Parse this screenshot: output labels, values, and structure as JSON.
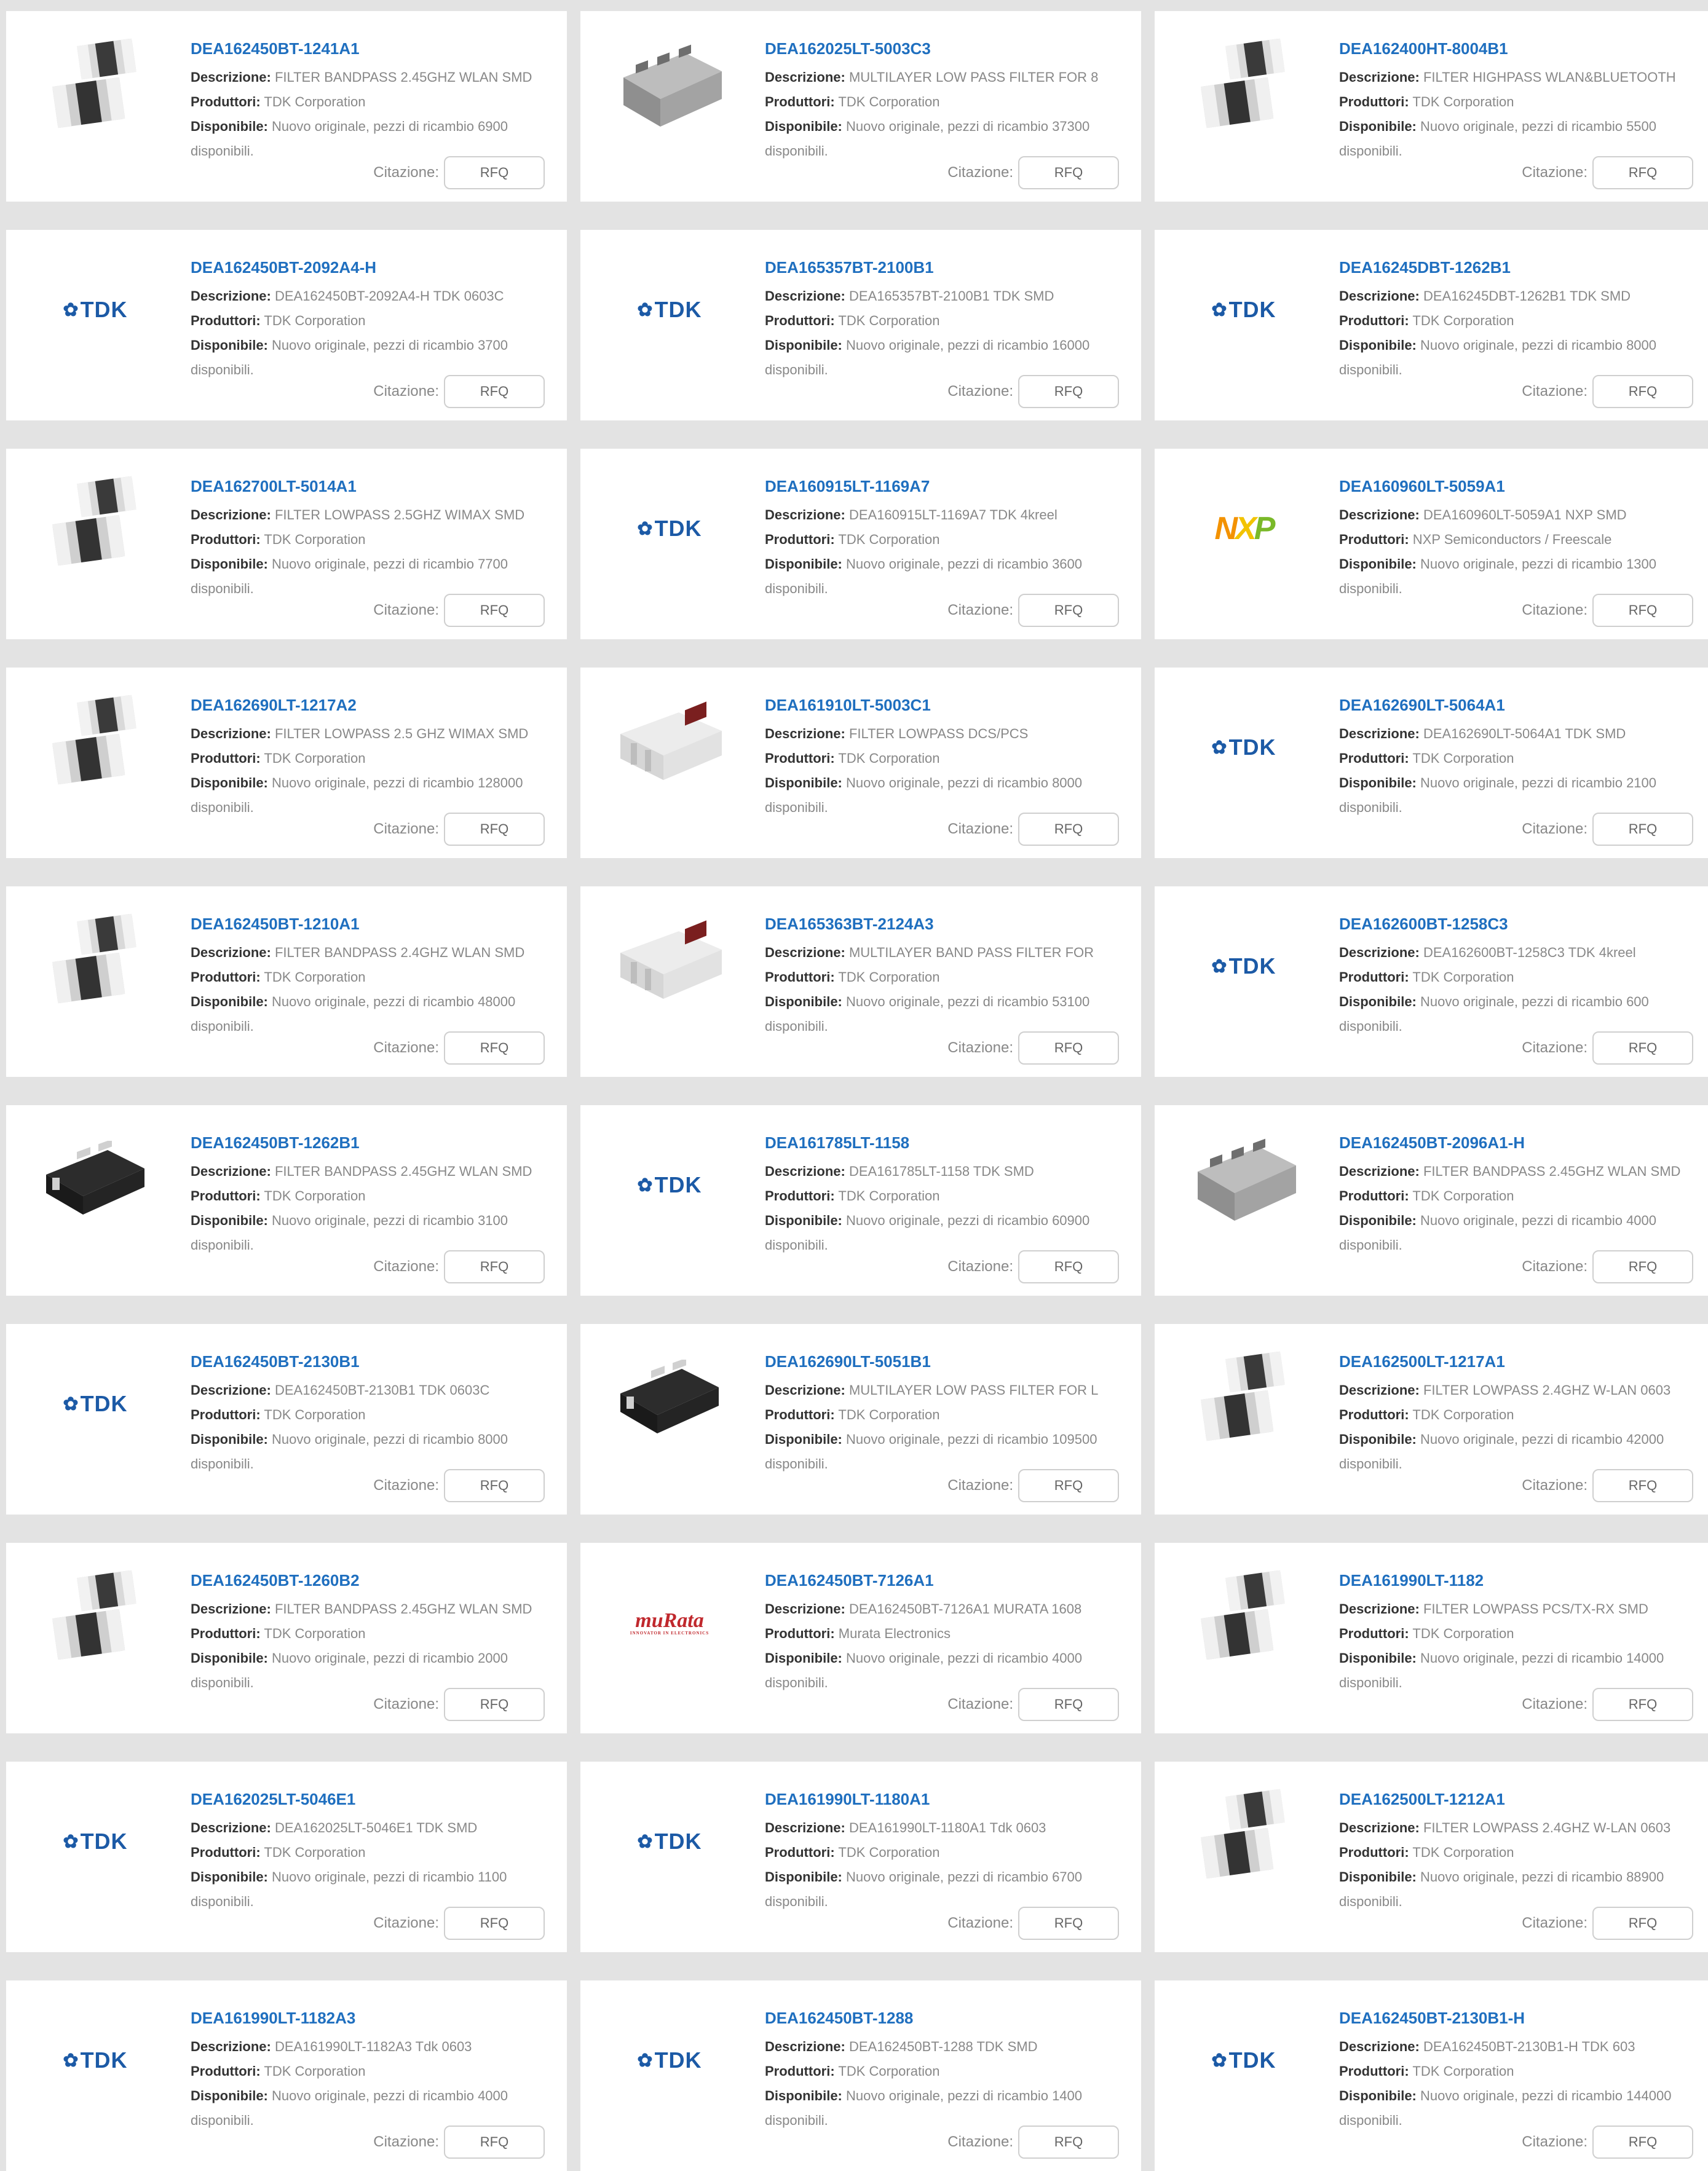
{
  "labels": {
    "descrizione": "Descrizione:",
    "produttori": "Produttori:",
    "disponibile": "Disponibile:",
    "citazione": "Citazione:",
    "rfq": "RFQ"
  },
  "brand_colors": {
    "link": "#1f6fbf",
    "tdk": "#1c5aa6",
    "murata": "#c0282d",
    "nxp_orange": "#f39200",
    "nxp_green": "#7ab929"
  },
  "products": [
    {
      "pn": "DEA162450BT-1241A1",
      "desc": "FILTER BANDPASS 2.45GHZ WLAN SMD",
      "mfr": "TDK Corporation",
      "avail": "Nuovo originale, pezzi di ricambio 6900 disponibili.",
      "img": "chip-pair-icon"
    },
    {
      "pn": "DEA162025LT-5003C3",
      "desc": "MULTILAYER LOW PASS FILTER FOR 8",
      "mfr": "TDK Corporation",
      "avail": "Nuovo originale, pezzi di ricambio 37300 disponibili.",
      "img": "chip-array-icon"
    },
    {
      "pn": "DEA162400HT-8004B1",
      "desc": "FILTER HIGHPASS WLAN&BLUETOOTH",
      "mfr": "TDK Corporation",
      "avail": "Nuovo originale, pezzi di ricambio 5500 disponibili.",
      "img": "chip-pair-icon"
    },
    {
      "pn": "DEA162450BT-2092A4-H",
      "desc": "DEA162450BT-2092A4-H TDK 0603C",
      "mfr": "TDK Corporation",
      "avail": "Nuovo originale, pezzi di ricambio 3700 disponibili.",
      "img": "tdk-logo"
    },
    {
      "pn": "DEA165357BT-2100B1",
      "desc": "DEA165357BT-2100B1 TDK SMD",
      "mfr": "TDK Corporation",
      "avail": "Nuovo originale, pezzi di ricambio 16000 disponibili.",
      "img": "tdk-logo"
    },
    {
      "pn": "DEA16245DBT-1262B1",
      "desc": "DEA16245DBT-1262B1 TDK SMD",
      "mfr": "TDK Corporation",
      "avail": "Nuovo originale, pezzi di ricambio 8000 disponibili.",
      "img": "tdk-logo"
    },
    {
      "pn": "DEA162700LT-5014A1",
      "desc": "FILTER LOWPASS 2.5GHZ WIMAX SMD",
      "mfr": "TDK Corporation",
      "avail": "Nuovo originale, pezzi di ricambio 7700 disponibili.",
      "img": "chip-pair-icon"
    },
    {
      "pn": "DEA160915LT-1169A7",
      "desc": "DEA160915LT-1169A7 TDK 4kreel",
      "mfr": "TDK Corporation",
      "avail": "Nuovo originale, pezzi di ricambio 3600 disponibili.",
      "img": "tdk-logo"
    },
    {
      "pn": "DEA160960LT-5059A1",
      "desc": "DEA160960LT-5059A1 NXP SMD",
      "mfr": "NXP Semiconductors / Freescale",
      "avail": "Nuovo originale, pezzi di ricambio 1300 disponibili.",
      "img": "nxp-logo"
    },
    {
      "pn": "DEA162690LT-1217A2",
      "desc": "FILTER LOWPASS 2.5 GHZ WIMAX SMD",
      "mfr": "TDK Corporation",
      "avail": "Nuovo originale, pezzi di ricambio 128000 disponibili.",
      "img": "chip-pair-icon"
    },
    {
      "pn": "DEA161910LT-5003C1",
      "desc": "FILTER LOWPASS DCS/PCS",
      "mfr": "TDK Corporation",
      "avail": "Nuovo originale, pezzi di ricambio 8000 disponibili.",
      "img": "chip-white-icon"
    },
    {
      "pn": "DEA162690LT-5064A1",
      "desc": "DEA162690LT-5064A1 TDK SMD",
      "mfr": "TDK Corporation",
      "avail": "Nuovo originale, pezzi di ricambio 2100 disponibili.",
      "img": "tdk-logo"
    },
    {
      "pn": "DEA162450BT-1210A1",
      "desc": "FILTER BANDPASS 2.4GHZ WLAN SMD",
      "mfr": "TDK Corporation",
      "avail": "Nuovo originale, pezzi di ricambio 48000 disponibili.",
      "img": "chip-pair-icon"
    },
    {
      "pn": "DEA165363BT-2124A3",
      "desc": "MULTILAYER BAND PASS FILTER FOR",
      "mfr": "TDK Corporation",
      "avail": "Nuovo originale, pezzi di ricambio 53100 disponibili.",
      "img": "chip-white-icon"
    },
    {
      "pn": "DEA162600BT-1258C3",
      "desc": "DEA162600BT-1258C3 TDK 4kreel",
      "mfr": "TDK Corporation",
      "avail": "Nuovo originale, pezzi di ricambio 600 disponibili.",
      "img": "tdk-logo"
    },
    {
      "pn": "DEA162450BT-1262B1",
      "desc": "FILTER BANDPASS 2.45GHZ WLAN SMD",
      "mfr": "TDK Corporation",
      "avail": "Nuovo originale, pezzi di ricambio 3100 disponibili.",
      "img": "chip-black-icon"
    },
    {
      "pn": "DEA161785LT-1158",
      "desc": "DEA161785LT-1158 TDK SMD",
      "mfr": "TDK Corporation",
      "avail": "Nuovo originale, pezzi di ricambio 60900 disponibili.",
      "img": "tdk-logo"
    },
    {
      "pn": "DEA162450BT-2096A1-H",
      "desc": "FILTER BANDPASS 2.45GHZ WLAN SMD",
      "mfr": "TDK Corporation",
      "avail": "Nuovo originale, pezzi di ricambio 4000 disponibili.",
      "img": "chip-array-icon"
    },
    {
      "pn": "DEA162450BT-2130B1",
      "desc": "DEA162450BT-2130B1 TDK 0603C",
      "mfr": "TDK Corporation",
      "avail": "Nuovo originale, pezzi di ricambio 8000 disponibili.",
      "img": "tdk-logo"
    },
    {
      "pn": "DEA162690LT-5051B1",
      "desc": "MULTILAYER LOW PASS FILTER FOR L",
      "mfr": "TDK Corporation",
      "avail": "Nuovo originale, pezzi di ricambio 109500 disponibili.",
      "img": "chip-black-icon"
    },
    {
      "pn": "DEA162500LT-1217A1",
      "desc": "FILTER LOWPASS 2.4GHZ W-LAN 0603",
      "mfr": "TDK Corporation",
      "avail": "Nuovo originale, pezzi di ricambio 42000 disponibili.",
      "img": "chip-pair-icon"
    },
    {
      "pn": "DEA162450BT-1260B2",
      "desc": "FILTER BANDPASS 2.45GHZ WLAN SMD",
      "mfr": "TDK Corporation",
      "avail": "Nuovo originale, pezzi di ricambio 2000 disponibili.",
      "img": "chip-pair-icon"
    },
    {
      "pn": "DEA162450BT-7126A1",
      "desc": "DEA162450BT-7126A1 MURATA 1608",
      "mfr": "Murata Electronics",
      "avail": "Nuovo originale, pezzi di ricambio 4000 disponibili.",
      "img": "murata-logo"
    },
    {
      "pn": "DEA161990LT-1182",
      "desc": "FILTER LOWPASS PCS/TX-RX SMD",
      "mfr": "TDK Corporation",
      "avail": "Nuovo originale, pezzi di ricambio 14000 disponibili.",
      "img": "chip-pair-icon"
    },
    {
      "pn": "DEA162025LT-5046E1",
      "desc": "DEA162025LT-5046E1 TDK SMD",
      "mfr": "TDK Corporation",
      "avail": "Nuovo originale, pezzi di ricambio 1100 disponibili.",
      "img": "tdk-logo"
    },
    {
      "pn": "DEA161990LT-1180A1",
      "desc": "DEA161990LT-1180A1 Tdk 0603",
      "mfr": "TDK Corporation",
      "avail": "Nuovo originale, pezzi di ricambio 6700 disponibili.",
      "img": "tdk-logo"
    },
    {
      "pn": "DEA162500LT-1212A1",
      "desc": "FILTER LOWPASS 2.4GHZ W-LAN 0603",
      "mfr": "TDK Corporation",
      "avail": "Nuovo originale, pezzi di ricambio 88900 disponibili.",
      "img": "chip-pair-icon"
    },
    {
      "pn": "DEA161990LT-1182A3",
      "desc": "DEA161990LT-1182A3 Tdk 0603",
      "mfr": "TDK Corporation",
      "avail": "Nuovo originale, pezzi di ricambio 4000 disponibili.",
      "img": "tdk-logo"
    },
    {
      "pn": "DEA162450BT-1288",
      "desc": "DEA162450BT-1288 TDK SMD",
      "mfr": "TDK Corporation",
      "avail": "Nuovo originale, pezzi di ricambio 1400 disponibili.",
      "img": "tdk-logo"
    },
    {
      "pn": "DEA162450BT-2130B1-H",
      "desc": "DEA162450BT-2130B1-H TDK 603",
      "mfr": "TDK Corporation",
      "avail": "Nuovo originale, pezzi di ricambio 144000 disponibili.",
      "img": "tdk-logo"
    }
  ]
}
